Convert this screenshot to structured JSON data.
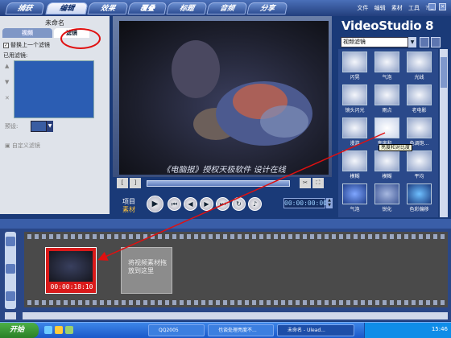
{
  "tabs": [
    {
      "label": "捕获"
    },
    {
      "label": "编辑"
    },
    {
      "label": "效果"
    },
    {
      "label": "覆叠"
    },
    {
      "label": "标题"
    },
    {
      "label": "音频"
    },
    {
      "label": "分享"
    }
  ],
  "menu": [
    "文件",
    "编辑",
    "素材",
    "工具",
    "?"
  ],
  "project_name": "未命名",
  "left_panel": {
    "video_tab": "视频",
    "filter_tab": "滤镜",
    "replace_checkbox": "替换上一个滤镜",
    "applied_filters_label": "已用滤镜:",
    "preset_label": "预设:",
    "custom_filter": "自定义滤镜"
  },
  "preview": {
    "watermark": "《电脑报》授权天极软件 设计在线",
    "project_label": "项目",
    "clip_label": "素材",
    "timecode": "00:00:00:00"
  },
  "app_title": "VideoStudio 8",
  "library": {
    "dropdown": "视频滤镜",
    "items": [
      {
        "label": "闪晃"
      },
      {
        "label": "气泡"
      },
      {
        "label": "光线"
      },
      {
        "label": "镜头闪光"
      },
      {
        "label": "雨点"
      },
      {
        "label": "老电影"
      },
      {
        "label": "漫游"
      },
      {
        "label": "亮度和..."
      },
      {
        "label": "色调饱..."
      },
      {
        "label": "模糊"
      },
      {
        "label": "模糊"
      },
      {
        "label": "平均"
      },
      {
        "label": "气泡"
      },
      {
        "label": "锐化"
      },
      {
        "label": "色彩偏移"
      }
    ],
    "tooltip": "亮度和对比度"
  },
  "timeline": {
    "clip_time": "00:00:18:10",
    "drop_hint": "将视频素材拖放到这里"
  },
  "taskbar": {
    "start": "开始",
    "tasks": [
      {
        "label": "QQ2005"
      },
      {
        "label": "也谈处理亮度不..."
      },
      {
        "label": "未命名 - Ulead..."
      }
    ],
    "clock": "15:46"
  },
  "colors": {
    "accent": "#2a498a",
    "highlight": "#e01010",
    "clip": "#d91a1a"
  }
}
